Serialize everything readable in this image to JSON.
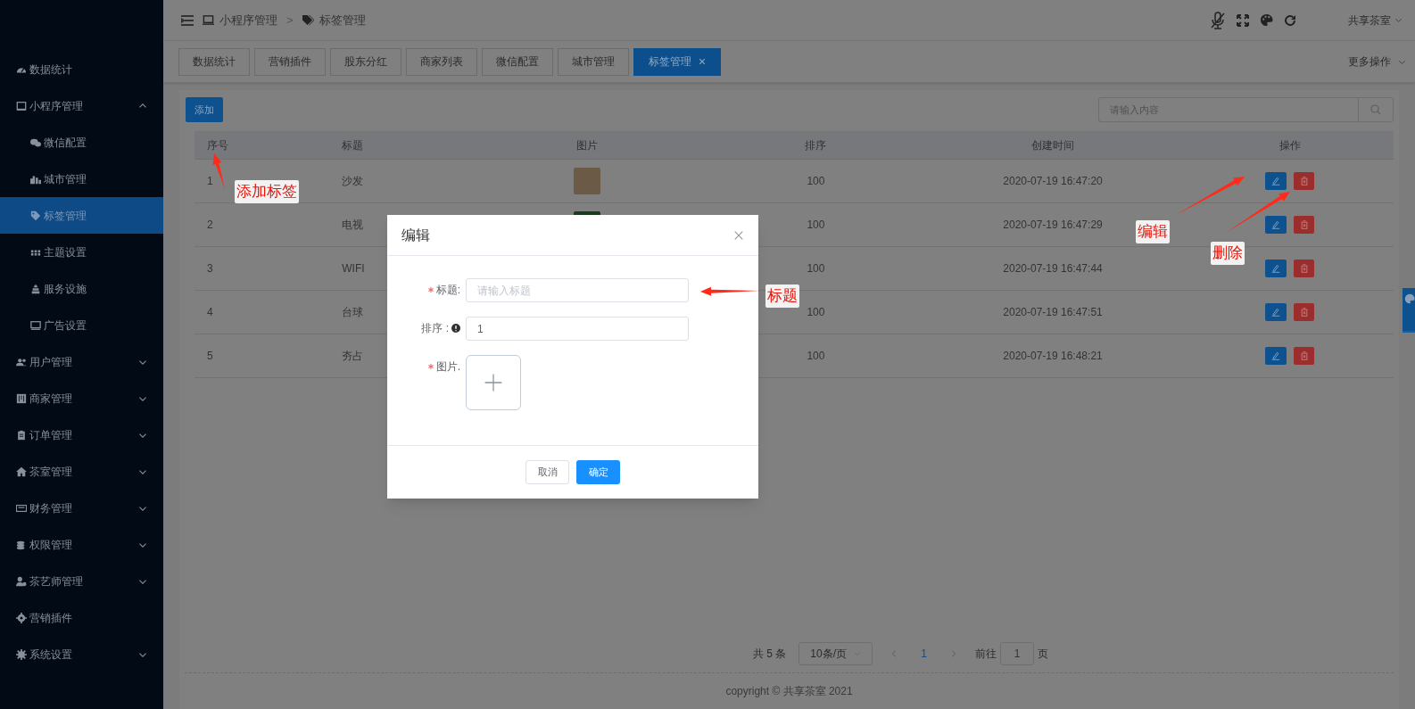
{
  "sidebar": {
    "items": [
      {
        "label": "数据统计",
        "selected": false
      },
      {
        "label": "小程序管理",
        "selected": false,
        "expanded": true,
        "children": [
          {
            "label": "微信配置",
            "selected": false
          },
          {
            "label": "城市管理",
            "selected": false
          },
          {
            "label": "标签管理",
            "selected": true
          },
          {
            "label": "主题设置",
            "selected": false
          },
          {
            "label": "服务设施",
            "selected": false
          },
          {
            "label": "广告设置",
            "selected": false
          }
        ]
      },
      {
        "label": "用户管理",
        "selected": false,
        "expanded": false
      },
      {
        "label": "商家管理",
        "selected": false,
        "expanded": false
      },
      {
        "label": "订单管理",
        "selected": false,
        "expanded": false
      },
      {
        "label": "茶室管理",
        "selected": false,
        "expanded": false
      },
      {
        "label": "财务管理",
        "selected": false,
        "expanded": false
      },
      {
        "label": "权限管理",
        "selected": false,
        "expanded": false
      },
      {
        "label": "茶艺师管理",
        "selected": false,
        "expanded": false
      },
      {
        "label": "营销插件",
        "selected": false
      },
      {
        "label": "系统设置",
        "selected": false,
        "expanded": false
      }
    ]
  },
  "header": {
    "breadcrumb": [
      "小程序管理",
      "标签管理"
    ],
    "separator": ">",
    "user": "共享茶室"
  },
  "tabs": [
    {
      "label": "数据统计",
      "selected": false
    },
    {
      "label": "营销插件",
      "selected": false
    },
    {
      "label": "股东分红",
      "selected": false
    },
    {
      "label": "商家列表",
      "selected": false
    },
    {
      "label": "微信配置",
      "selected": false
    },
    {
      "label": "城市管理",
      "selected": false
    },
    {
      "label": "标签管理",
      "selected": true,
      "closable": true
    }
  ],
  "more_actions": "更多操作",
  "toolbar": {
    "add_button": "添加",
    "search": {
      "placeholder": "请输入内容"
    }
  },
  "table": {
    "columns": [
      "序号",
      "标题",
      "图片",
      "排序",
      "创建时间",
      "操作"
    ],
    "rows": [
      {
        "index": "1",
        "title": "沙发",
        "image": true,
        "sort": "100",
        "created": "2020-07-19 16:47:20"
      },
      {
        "index": "2",
        "title": "电视",
        "image": true,
        "sort": "100",
        "created": "2020-07-19 16:47:29"
      },
      {
        "index": "3",
        "title": "WIFI",
        "sort": "100",
        "created": "2020-07-19 16:47:44"
      },
      {
        "index": "4",
        "title": "台球",
        "sort": "100",
        "created": "2020-07-19 16:47:51"
      },
      {
        "index": "5",
        "title": "夯占",
        "sort": "100",
        "created": "2020-07-19 16:48:21"
      }
    ]
  },
  "pagination": {
    "total": "共 5 条",
    "page_size": "10条/页",
    "pages": [
      {
        "label": "1",
        "selected": true
      }
    ],
    "goto_label": "前往",
    "goto_value": "1",
    "goto_suffix": "页"
  },
  "footer": "copyright © 共享茶室 2021",
  "dialog": {
    "title": "编辑",
    "fields": [
      {
        "kind": "text",
        "label": "标题:",
        "required": true,
        "placeholder": "请输入标题"
      },
      {
        "kind": "number",
        "label": "排序 :",
        "required": false,
        "info": true,
        "value": "1"
      },
      {
        "kind": "upload",
        "label": "图片.",
        "required": true
      }
    ],
    "cancel": "取消",
    "confirm": "确定"
  },
  "annotations": [
    "添加标签",
    "编辑",
    "删除",
    "标题"
  ]
}
